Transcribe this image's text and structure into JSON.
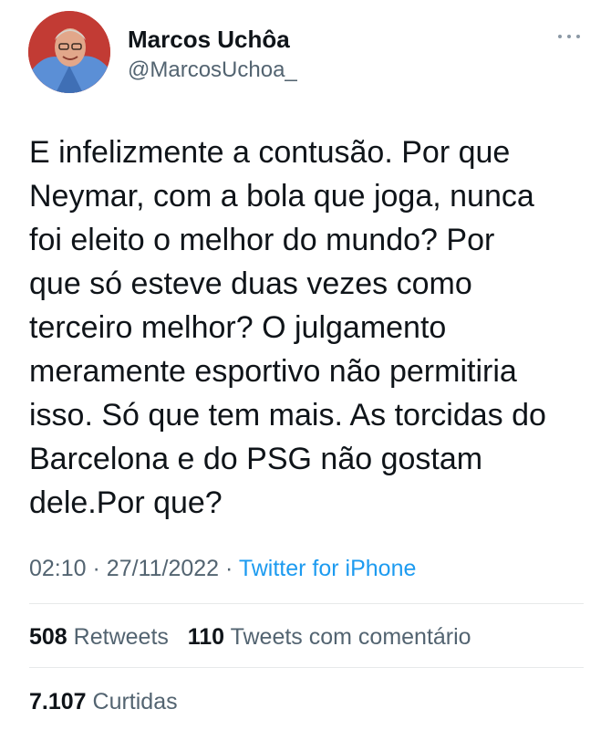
{
  "author": {
    "display_name": "Marcos Uchôa",
    "handle": "@MarcosUchoa_"
  },
  "tweet": {
    "text_lines": [
      "E infelizmente a contusão. Por que",
      "Neymar, com a bola que joga, nunca",
      "foi eleito o melhor do mundo? Por",
      "que só esteve duas vezes como",
      "terceiro melhor? O julgamento",
      "meramente esportivo não permitiria",
      "isso. Só que tem mais. As torcidas do",
      "Barcelona e do PSG não gostam",
      "dele.Por que?"
    ],
    "time": "02:10",
    "separator": "·",
    "date": "27/11/2022",
    "source": "Twitter for iPhone"
  },
  "stats": {
    "retweets_count": "508",
    "retweets_label": "Retweets",
    "quotes_count": "110",
    "quotes_label": "Tweets com comentário",
    "likes_count": "7.107",
    "likes_label": "Curtidas"
  },
  "colors": {
    "text": "#0f1419",
    "secondary": "#536471",
    "link": "#1d9bf0",
    "divider": "#e7e9ea"
  }
}
